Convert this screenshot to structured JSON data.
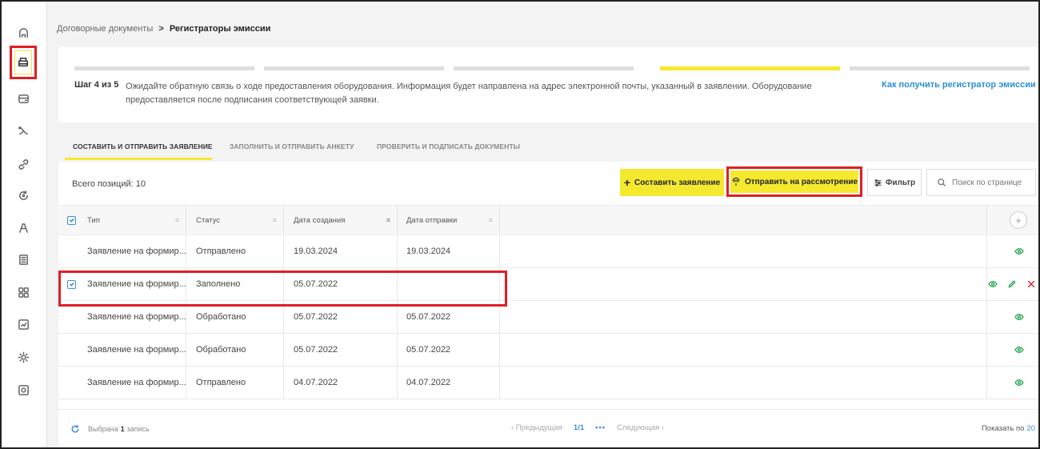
{
  "sidebar": {
    "items": [
      {
        "icon": "home-icon"
      },
      {
        "icon": "printer-icon",
        "active": true
      },
      {
        "icon": "wallet-icon"
      },
      {
        "icon": "handshake-icon"
      },
      {
        "icon": "link-icon"
      },
      {
        "icon": "refresh-icon"
      },
      {
        "icon": "user-icon"
      },
      {
        "icon": "document-list-icon"
      },
      {
        "icon": "grid-icon"
      },
      {
        "icon": "chart-icon"
      },
      {
        "icon": "settings-icon"
      },
      {
        "icon": "archive-icon"
      }
    ]
  },
  "breadcrumb": {
    "parent": "Договорные документы",
    "separator": ">",
    "current": "Регистраторы эмиссии"
  },
  "stepper": {
    "total_steps": 5,
    "current_step": 4,
    "step_label": "Шаг 4 из 5",
    "text": "Ожидайте обратную связь о ходе предоставления оборудования. Информация будет направлена на адрес электронной почты, указанный в заявлении. Оборудование предоставляется после подписания соответствующей заявки.",
    "help_link": "Как получить регистратор эмиссии"
  },
  "tabs": [
    {
      "label": "СОСТАВИТЬ И ОТПРАВИТЬ ЗАЯВЛЕНИЕ",
      "active": true
    },
    {
      "label": "ЗАПОЛНИТЬ И ОТПРАВИТЬ АНКЕТУ",
      "active": false
    },
    {
      "label": "ПРОВЕРИТЬ И ПОДПИСАТЬ ДОКУМЕНТЫ",
      "active": false
    }
  ],
  "toolbar": {
    "total_label": "Всего позиций: 10",
    "create_label": "Составить заявление",
    "send_label": "Отправить на рассмотрение",
    "filter_label": "Фильтр",
    "search_placeholder": "Поиск по странице"
  },
  "table": {
    "columns": [
      "Тип",
      "Статус",
      "Дата создания",
      "Дата отправки"
    ],
    "rows": [
      {
        "type": "Заявление на формир...",
        "status": "Отправлено",
        "created": "19.03.2024",
        "sent": "19.03.2024",
        "checked": false,
        "actions": [
          "view"
        ]
      },
      {
        "type": "Заявление на формир...",
        "status": "Заполнено",
        "created": "05.07.2022",
        "sent": "",
        "checked": true,
        "actions": [
          "view",
          "edit",
          "delete"
        ]
      },
      {
        "type": "Заявление на формир...",
        "status": "Обработано",
        "created": "05.07.2022",
        "sent": "05.07.2022",
        "checked": false,
        "actions": [
          "view"
        ]
      },
      {
        "type": "Заявление на формир...",
        "status": "Обработано",
        "created": "05.07.2022",
        "sent": "05.07.2022",
        "checked": false,
        "actions": [
          "view"
        ]
      },
      {
        "type": "Заявление на формир...",
        "status": "Отправлено",
        "created": "04.07.2022",
        "sent": "04.07.2022",
        "checked": false,
        "actions": [
          "view"
        ]
      }
    ]
  },
  "footer": {
    "selected_prefix": "Выбрана",
    "selected_count": "1",
    "selected_suffix": "запись",
    "prev_label": "‹  Предыдущая",
    "page": "1/1",
    "dots": "•••",
    "next_label": "Следующая  ›",
    "show_label": "Показать по",
    "show_value": "20"
  },
  "colors": {
    "accent_yellow": "#f5e930",
    "highlight_red": "#e01e26",
    "link_blue": "#2b8fd6",
    "action_green": "#27a550"
  }
}
